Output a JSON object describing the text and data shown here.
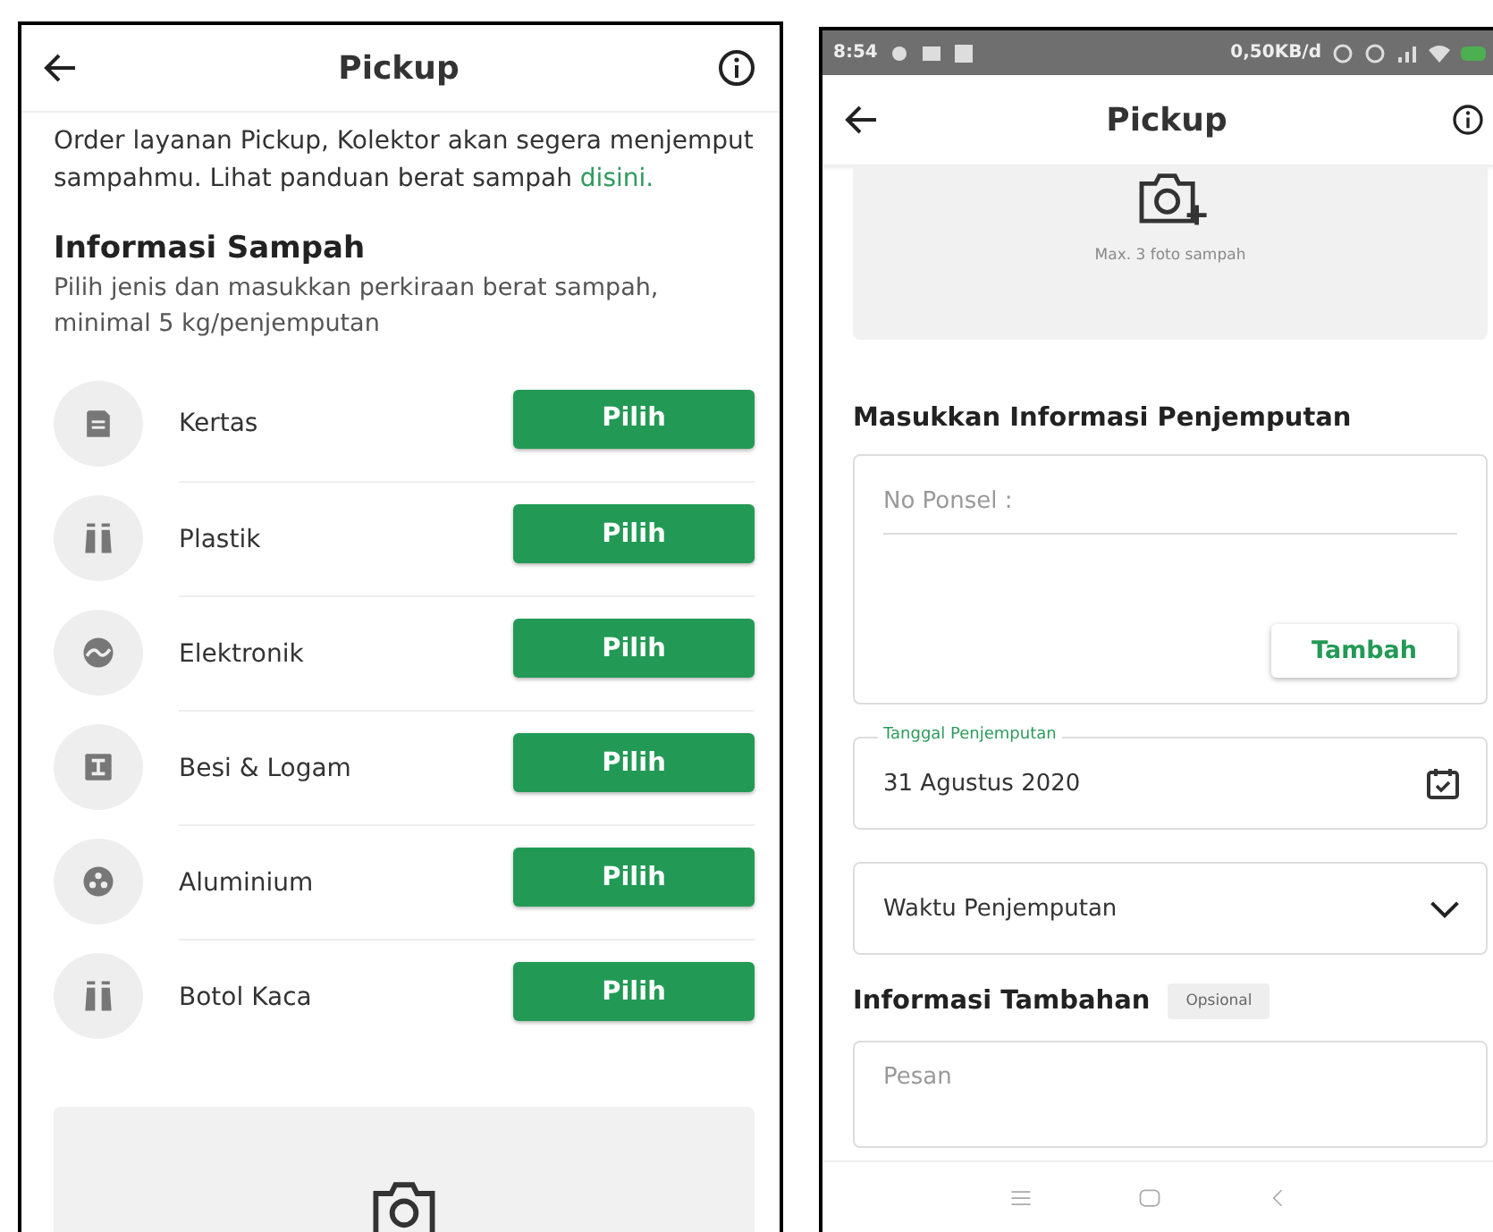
{
  "left_screen": {
    "header": {
      "title": "Pickup"
    },
    "intro": {
      "text": "Order layanan Pickup, Kolektor akan segera menjemput sampahmu. Lihat panduan berat sampah",
      "link": "disini."
    },
    "section": {
      "title": "Informasi Sampah",
      "subtitle": "Pilih jenis dan masukkan perkiraan berat sampah, minimal 5 kg/penjemputan"
    },
    "categories": [
      {
        "kind": "paper",
        "label": "Kertas",
        "button": "Pilih"
      },
      {
        "kind": "bottle",
        "label": "Plastik",
        "button": "Pilih"
      },
      {
        "kind": "electronic",
        "label": "Elektronik",
        "button": "Pilih"
      },
      {
        "kind": "metal",
        "label": "Besi & Logam",
        "button": "Pilih"
      },
      {
        "kind": "can",
        "label": "Aluminium",
        "button": "Pilih"
      },
      {
        "kind": "bottle",
        "label": "Botol Kaca",
        "button": "Pilih"
      }
    ]
  },
  "right_screen": {
    "status_bar": {
      "time": "8:54",
      "net_speed": "0,50KB/d"
    },
    "header": {
      "title": "Pickup"
    },
    "photo_upload": {
      "hint": "Max. 3 foto sampah"
    },
    "pickup_section": {
      "title": "Masukkan Informasi Penjemputan"
    },
    "phone_field": {
      "placeholder": "No Ponsel :",
      "button": "Tambah"
    },
    "date_field": {
      "label": "Tanggal Penjemputan",
      "value": "31 Agustus 2020"
    },
    "time_dropdown": {
      "placeholder": "Waktu Penjemputan"
    },
    "extra_section": {
      "title": "Informasi Tambahan",
      "badge": "Opsional"
    },
    "message_field": {
      "placeholder": "Pesan"
    }
  }
}
